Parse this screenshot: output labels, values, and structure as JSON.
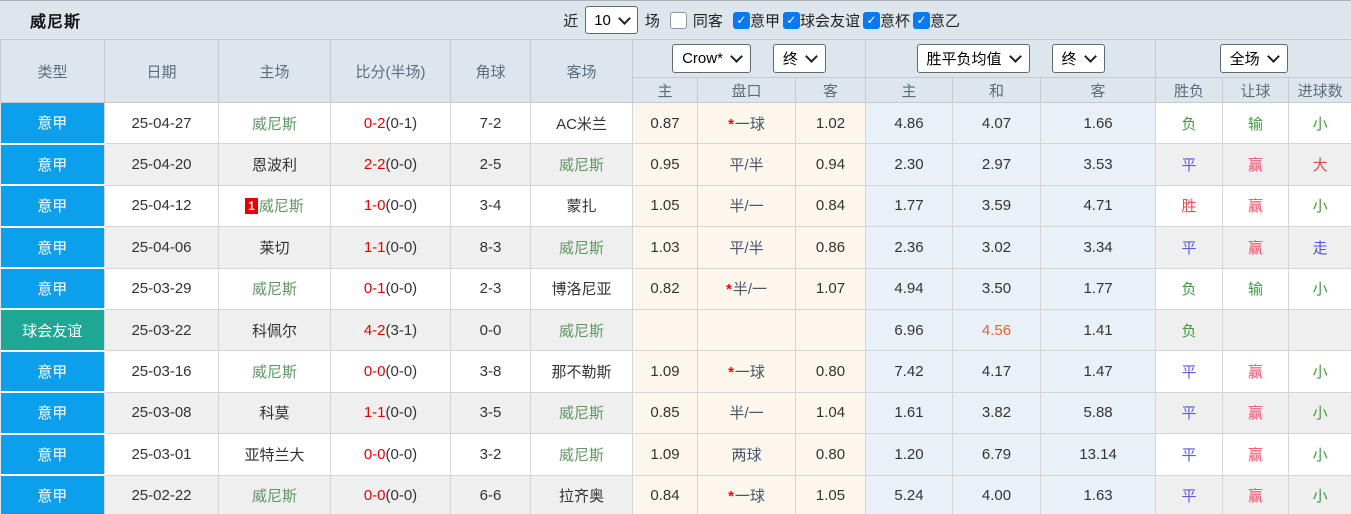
{
  "title": "威尼斯",
  "filter_bar": {
    "recent_label": "近",
    "recent_value": "10",
    "games_label": "场",
    "same_away_label": "同客",
    "same_away_checked": false,
    "filters": [
      {
        "label": "意甲",
        "checked": true
      },
      {
        "label": "球会友谊",
        "checked": true
      },
      {
        "label": "意杯",
        "checked": true
      },
      {
        "label": "意乙",
        "checked": true
      }
    ]
  },
  "icons": {
    "check": "✓"
  },
  "table": {
    "columns": [
      "类型",
      "日期",
      "主场",
      "比分(半场)",
      "角球",
      "客场"
    ],
    "dropdowns": {
      "company": "Crow*",
      "final1": "终",
      "avg": "胜平负均值",
      "final2": "终",
      "scope": "全场"
    },
    "subheaders": [
      "主",
      "盘口",
      "客",
      "主",
      "和",
      "客",
      "胜负",
      "让球",
      "进球数"
    ],
    "rows": [
      {
        "league": "意甲",
        "league_type": "league",
        "date": "25-04-27",
        "home": "威尼斯",
        "home_is_target": true,
        "home_badge": "",
        "score": "0-2",
        "half": "(0-1)",
        "corner": "7-2",
        "away": "AC米兰",
        "away_is_target": false,
        "odds_home": "0.87",
        "handicap": "一球",
        "handicap_star": true,
        "odds_away": "1.02",
        "avg_home": "4.86",
        "avg_draw": "4.07",
        "avg_away": "1.66",
        "avg_draw_highlight": false,
        "result": "负",
        "result_kind": "loss",
        "spread": "输",
        "spread_kind": "loss",
        "goals": "小",
        "goals_kind": "small"
      },
      {
        "league": "意甲",
        "league_type": "league",
        "date": "25-04-20",
        "home": "恩波利",
        "home_is_target": false,
        "home_badge": "",
        "score": "2-2",
        "half": "(0-0)",
        "corner": "2-5",
        "away": "威尼斯",
        "away_is_target": true,
        "odds_home": "0.95",
        "handicap": "平/半",
        "handicap_star": false,
        "odds_away": "0.94",
        "avg_home": "2.30",
        "avg_draw": "2.97",
        "avg_away": "3.53",
        "avg_draw_highlight": false,
        "result": "平",
        "result_kind": "draw",
        "spread": "赢",
        "spread_kind": "win",
        "goals": "大",
        "goals_kind": "big"
      },
      {
        "league": "意甲",
        "league_type": "league",
        "date": "25-04-12",
        "home": "威尼斯",
        "home_is_target": true,
        "home_badge": "1",
        "score": "1-0",
        "half": "(0-0)",
        "corner": "3-4",
        "away": "蒙扎",
        "away_is_target": false,
        "odds_home": "1.05",
        "handicap": "半/一",
        "handicap_star": false,
        "odds_away": "0.84",
        "avg_home": "1.77",
        "avg_draw": "3.59",
        "avg_away": "4.71",
        "avg_draw_highlight": false,
        "result": "胜",
        "result_kind": "win",
        "spread": "赢",
        "spread_kind": "win",
        "goals": "小",
        "goals_kind": "small"
      },
      {
        "league": "意甲",
        "league_type": "league",
        "date": "25-04-06",
        "home": "莱切",
        "home_is_target": false,
        "home_badge": "",
        "score": "1-1",
        "half": "(0-0)",
        "corner": "8-3",
        "away": "威尼斯",
        "away_is_target": true,
        "odds_home": "1.03",
        "handicap": "平/半",
        "handicap_star": false,
        "odds_away": "0.86",
        "avg_home": "2.36",
        "avg_draw": "3.02",
        "avg_away": "3.34",
        "avg_draw_highlight": false,
        "result": "平",
        "result_kind": "draw",
        "spread": "赢",
        "spread_kind": "win",
        "goals": "走",
        "goals_kind": "walk"
      },
      {
        "league": "意甲",
        "league_type": "league",
        "date": "25-03-29",
        "home": "威尼斯",
        "home_is_target": true,
        "home_badge": "",
        "score": "0-1",
        "half": "(0-0)",
        "corner": "2-3",
        "away": "博洛尼亚",
        "away_is_target": false,
        "odds_home": "0.82",
        "handicap": "半/一",
        "handicap_star": true,
        "odds_away": "1.07",
        "avg_home": "4.94",
        "avg_draw": "3.50",
        "avg_away": "1.77",
        "avg_draw_highlight": false,
        "result": "负",
        "result_kind": "loss",
        "spread": "输",
        "spread_kind": "loss",
        "goals": "小",
        "goals_kind": "small"
      },
      {
        "league": "球会友谊",
        "league_type": "friendly",
        "date": "25-03-22",
        "home": "科佩尔",
        "home_is_target": false,
        "home_badge": "",
        "score": "4-2",
        "half": "(3-1)",
        "corner": "0-0",
        "away": "威尼斯",
        "away_is_target": true,
        "odds_home": "",
        "handicap": "",
        "handicap_star": false,
        "odds_away": "",
        "avg_home": "6.96",
        "avg_draw": "4.56",
        "avg_away": "1.41",
        "avg_draw_highlight": true,
        "result": "负",
        "result_kind": "loss",
        "spread": "",
        "spread_kind": "",
        "goals": "",
        "goals_kind": ""
      },
      {
        "league": "意甲",
        "league_type": "league",
        "date": "25-03-16",
        "home": "威尼斯",
        "home_is_target": true,
        "home_badge": "",
        "score": "0-0",
        "half": "(0-0)",
        "corner": "3-8",
        "away": "那不勒斯",
        "away_is_target": false,
        "odds_home": "1.09",
        "handicap": "一球",
        "handicap_star": true,
        "odds_away": "0.80",
        "avg_home": "7.42",
        "avg_draw": "4.17",
        "avg_away": "1.47",
        "avg_draw_highlight": false,
        "result": "平",
        "result_kind": "draw",
        "spread": "赢",
        "spread_kind": "win",
        "goals": "小",
        "goals_kind": "small"
      },
      {
        "league": "意甲",
        "league_type": "league",
        "date": "25-03-08",
        "home": "科莫",
        "home_is_target": false,
        "home_badge": "",
        "score": "1-1",
        "half": "(0-0)",
        "corner": "3-5",
        "away": "威尼斯",
        "away_is_target": true,
        "odds_home": "0.85",
        "handicap": "半/一",
        "handicap_star": false,
        "odds_away": "1.04",
        "avg_home": "1.61",
        "avg_draw": "3.82",
        "avg_away": "5.88",
        "avg_draw_highlight": false,
        "result": "平",
        "result_kind": "draw",
        "spread": "赢",
        "spread_kind": "win",
        "goals": "小",
        "goals_kind": "small"
      },
      {
        "league": "意甲",
        "league_type": "league",
        "date": "25-03-01",
        "home": "亚特兰大",
        "home_is_target": false,
        "home_badge": "",
        "score": "0-0",
        "half": "(0-0)",
        "corner": "3-2",
        "away": "威尼斯",
        "away_is_target": true,
        "odds_home": "1.09",
        "handicap": "两球",
        "handicap_star": false,
        "odds_away": "0.80",
        "avg_home": "1.20",
        "avg_draw": "6.79",
        "avg_away": "13.14",
        "avg_draw_highlight": false,
        "result": "平",
        "result_kind": "draw",
        "spread": "赢",
        "spread_kind": "win",
        "goals": "小",
        "goals_kind": "small"
      },
      {
        "league": "意甲",
        "league_type": "league",
        "date": "25-02-22",
        "home": "威尼斯",
        "home_is_target": true,
        "home_badge": "",
        "score": "0-0",
        "half": "(0-0)",
        "corner": "6-6",
        "away": "拉齐奥",
        "away_is_target": false,
        "odds_home": "0.84",
        "handicap": "一球",
        "handicap_star": true,
        "odds_away": "1.05",
        "avg_home": "5.24",
        "avg_draw": "4.00",
        "avg_away": "1.63",
        "avg_draw_highlight": false,
        "result": "平",
        "result_kind": "draw",
        "spread": "赢",
        "spread_kind": "win",
        "goals": "小",
        "goals_kind": "small"
      }
    ]
  },
  "colors": {
    "league_blue": "#0b9fec",
    "friendly_teal": "#1ea795",
    "checkbox_blue": "#0a78f0",
    "target_team_green": "#5e9663",
    "score_red": "#e60000",
    "star_red": "#ff0000",
    "result_win": "#e64a4a",
    "result_draw": "#5b5bdd",
    "result_loss": "#3f9b3f",
    "spread_win": "#f0506e",
    "spread_loss": "#3f9b3f",
    "goals_big": "#e64a4a",
    "goals_small": "#3f9b3f",
    "goals_walk": "#5050dd",
    "highlight_orange": "#e8612f"
  }
}
